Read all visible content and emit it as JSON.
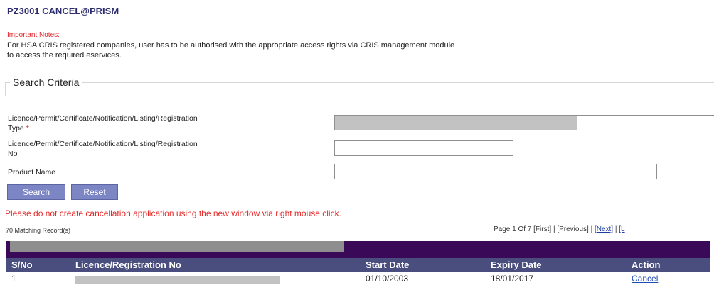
{
  "page": {
    "title": "PZ3001 CANCEL@PRISM"
  },
  "notes": {
    "heading": "Important Notes:",
    "line1": "For HSA CRIS registered companies, user has to be authorised with the appropriate access rights via CRIS management module",
    "line2": "to access the required eservices."
  },
  "search": {
    "legend": "Search Criteria",
    "type_label_line1": "Licence/Permit/Certificate/Notification/Listing/Registration",
    "type_label_line2": "Type",
    "required_mark": "*",
    "type_value": "",
    "no_label_line1": "Licence/Permit/Certificate/Notification/Listing/Registration",
    "no_label_line2": "No",
    "no_value": "",
    "product_label": "Product Name",
    "product_value": "",
    "search_button": "Search",
    "reset_button": "Reset"
  },
  "warning": "Please do not create cancellation application using the new window via right mouse click.",
  "results": {
    "count_text": "70 Matching Record(s)",
    "pager_prefix": "Page  1  Of  7",
    "first": "[First]",
    "previous": "[Previous]",
    "next": "[Next]",
    "last": "[L",
    "sep": "|"
  },
  "table": {
    "headers": [
      "S/No",
      "Licence/Registration No",
      "Start Date",
      "Expiry Date",
      "Action"
    ],
    "rows": [
      {
        "sno": "1",
        "licence_no": "",
        "start_date": "01/10/2003",
        "expiry_date": "18/01/2017",
        "action": "Cancel"
      }
    ]
  },
  "colors": {
    "accent": "#3a0a58",
    "button": "#7d86c4",
    "warning": "#e62a2a"
  }
}
